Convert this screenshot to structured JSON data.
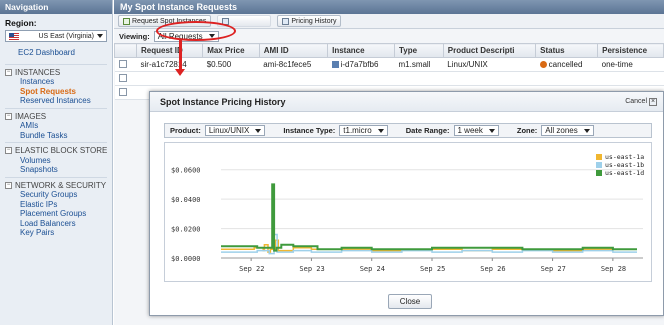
{
  "sidebar": {
    "title": "Navigation",
    "region_label": "Region:",
    "region_value": "US East (Virginia)",
    "items": [
      {
        "type": "link",
        "label": "EC2 Dashboard"
      },
      {
        "type": "section",
        "label": "INSTANCES"
      },
      {
        "type": "link",
        "label": "Instances"
      },
      {
        "type": "link",
        "label": "Spot Requests",
        "active": true
      },
      {
        "type": "link",
        "label": "Reserved Instances"
      },
      {
        "type": "section",
        "label": "IMAGES"
      },
      {
        "type": "link",
        "label": "AMIs"
      },
      {
        "type": "link",
        "label": "Bundle Tasks"
      },
      {
        "type": "section",
        "label": "ELASTIC BLOCK STORE"
      },
      {
        "type": "link",
        "label": "Volumes"
      },
      {
        "type": "link",
        "label": "Snapshots"
      },
      {
        "type": "section",
        "label": "NETWORK & SECURITY"
      },
      {
        "type": "link",
        "label": "Security Groups"
      },
      {
        "type": "link",
        "label": "Elastic IPs"
      },
      {
        "type": "link",
        "label": "Placement Groups"
      },
      {
        "type": "link",
        "label": "Load Balancers"
      },
      {
        "type": "link",
        "label": "Key Pairs"
      }
    ]
  },
  "main": {
    "title": "My Spot Instance Requests",
    "toolbar": {
      "request_label": "Request Spot Instances",
      "pricing_label": "Pricing History"
    },
    "viewing_label": "Viewing:",
    "viewing_value": "All Requests",
    "columns": [
      "Request ID",
      "Max Price",
      "AMI ID",
      "Instance",
      "Type",
      "Product Descripti",
      "Status",
      "Persistence"
    ],
    "rows": [
      {
        "request_id": "sir-a1c72814",
        "max_price": "$0.500",
        "ami_id": "ami-8c1fece5",
        "instance": "i-d7a7bfb6",
        "type": "m1.small",
        "product": "Linux/UNIX",
        "status": "cancelled",
        "persistence": "one-time"
      }
    ]
  },
  "modal": {
    "title": "Spot Instance Pricing History",
    "cancel_label": "Cancel",
    "close_label": "Close",
    "filters": {
      "product_label": "Product:",
      "product_value": "Linux/UNIX",
      "instance_type_label": "Instance Type:",
      "instance_type_value": "t1.micro",
      "date_range_label": "Date Range:",
      "date_range_value": "1 week",
      "zone_label": "Zone:",
      "zone_value": "All zones"
    }
  },
  "chart_data": {
    "type": "line",
    "title": "",
    "xlabel": "",
    "ylabel": "",
    "ylim": [
      0,
      0.07
    ],
    "x_ticks": [
      "Sep 22",
      "Sep 23",
      "Sep 24",
      "Sep 25",
      "Sep 26",
      "Sep 27",
      "Sep 28"
    ],
    "y_ticks": [
      "$0.0000",
      "$0.0200",
      "$0.0400",
      "$0.0600"
    ],
    "legend_position": "top-right",
    "grid": true,
    "series": [
      {
        "name": "us-east-1a",
        "color": "#f0b630",
        "points": [
          [
            0,
            0.006
          ],
          [
            0.4,
            0.006
          ],
          [
            0.55,
            0.007
          ],
          [
            0.7,
            0.005
          ],
          [
            0.72,
            0.009
          ],
          [
            0.78,
            0.004
          ],
          [
            0.82,
            0.006
          ],
          [
            0.9,
            0.012
          ],
          [
            0.95,
            0.005
          ],
          [
            1.2,
            0.007
          ],
          [
            1.5,
            0.006
          ],
          [
            2.0,
            0.006
          ],
          [
            2.5,
            0.005
          ],
          [
            3.0,
            0.006
          ],
          [
            3.5,
            0.006
          ],
          [
            4.0,
            0.005
          ],
          [
            4.5,
            0.006
          ],
          [
            5.0,
            0.006
          ],
          [
            5.5,
            0.005
          ],
          [
            6.0,
            0.006
          ],
          [
            6.5,
            0.006
          ],
          [
            6.9,
            0.006
          ]
        ]
      },
      {
        "name": "us-east-1b",
        "color": "#9ed0ea",
        "points": [
          [
            0,
            0.004
          ],
          [
            0.4,
            0.004
          ],
          [
            0.6,
            0.005
          ],
          [
            0.8,
            0.003
          ],
          [
            0.88,
            0.016
          ],
          [
            0.93,
            0.004
          ],
          [
            1.2,
            0.005
          ],
          [
            1.5,
            0.004
          ],
          [
            2.0,
            0.005
          ],
          [
            2.5,
            0.004
          ],
          [
            3.0,
            0.005
          ],
          [
            3.5,
            0.004
          ],
          [
            4.0,
            0.005
          ],
          [
            4.5,
            0.004
          ],
          [
            5.0,
            0.005
          ],
          [
            5.5,
            0.004
          ],
          [
            6.0,
            0.005
          ],
          [
            6.5,
            0.004
          ],
          [
            6.9,
            0.004
          ]
        ]
      },
      {
        "name": "us-east-1d",
        "color": "#3f9a3c",
        "points": [
          [
            0,
            0.008
          ],
          [
            0.4,
            0.008
          ],
          [
            0.6,
            0.007
          ],
          [
            0.82,
            0.007
          ],
          [
            0.85,
            0.05
          ],
          [
            0.88,
            0.005
          ],
          [
            0.92,
            0.007
          ],
          [
            1.0,
            0.009
          ],
          [
            1.2,
            0.008
          ],
          [
            1.6,
            0.006
          ],
          [
            2.0,
            0.007
          ],
          [
            2.5,
            0.006
          ],
          [
            3.0,
            0.006
          ],
          [
            3.5,
            0.007
          ],
          [
            4.0,
            0.007
          ],
          [
            4.5,
            0.007
          ],
          [
            5.0,
            0.006
          ],
          [
            5.5,
            0.006
          ],
          [
            6.0,
            0.007
          ],
          [
            6.5,
            0.006
          ],
          [
            6.9,
            0.006
          ]
        ]
      }
    ]
  }
}
